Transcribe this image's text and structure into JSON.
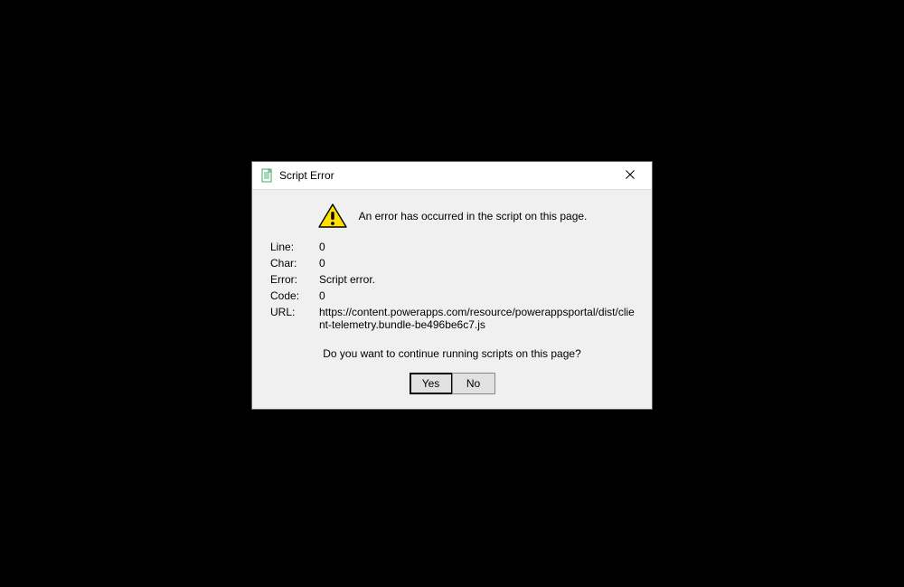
{
  "dialog": {
    "title": "Script Error",
    "banner_text": "An error has occurred in the script on this page.",
    "fields": {
      "line_label": "Line:",
      "line_value": "0",
      "char_label": "Char:",
      "char_value": "0",
      "error_label": "Error:",
      "error_value": "Script error.",
      "code_label": "Code:",
      "code_value": "0",
      "url_label": "URL:",
      "url_value": "https://content.powerapps.com/resource/powerappsportal/dist/client-telemetry.bundle-be496be6c7.js"
    },
    "question": "Do you want to continue running scripts on this page?",
    "buttons": {
      "yes": "Yes",
      "no": "No"
    }
  }
}
